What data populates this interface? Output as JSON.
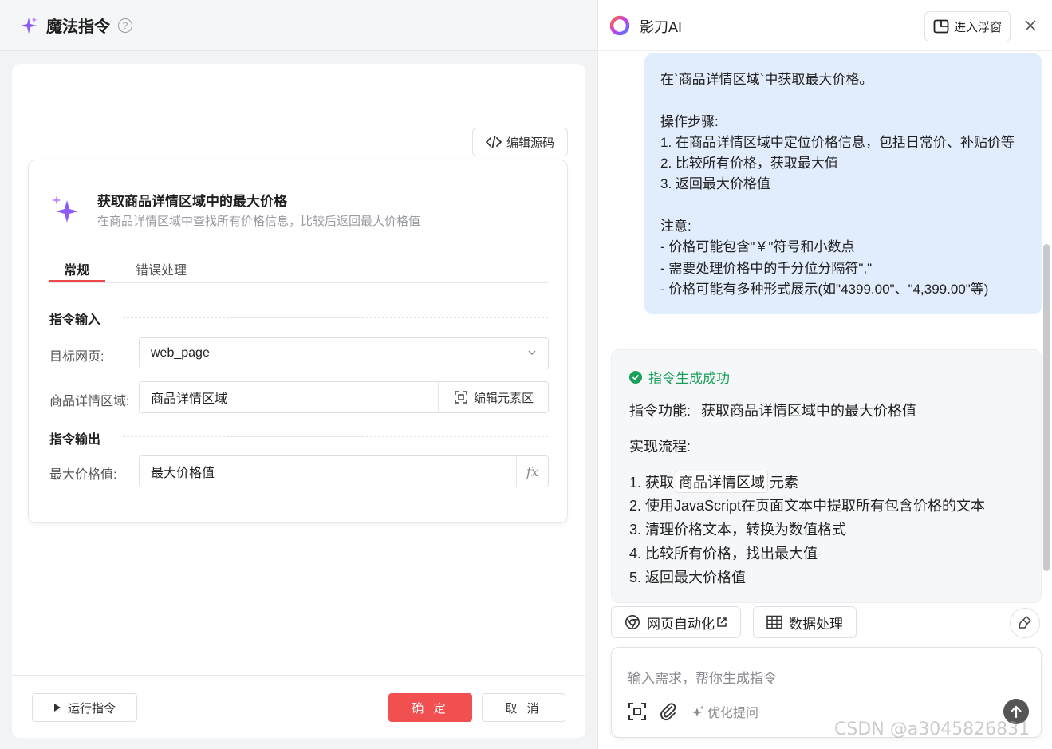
{
  "left": {
    "title": "魔法指令",
    "edit_source_label": "编辑源码",
    "command": {
      "title": "获取商品详情区域中的最大价格",
      "description": "在商品详情区域中查找所有价格信息，比较后返回最大价格值"
    },
    "tabs": [
      "常规",
      "错误处理"
    ],
    "active_tab": "常规",
    "input_section": "指令输入",
    "output_section": "指令输出",
    "fields": {
      "target_page_label": "目标网页:",
      "target_page_value": "web_page",
      "detail_area_label": "商品详情区域:",
      "detail_area_value": "商品详情区域",
      "edit_element_label": "编辑元素区",
      "max_price_label": "最大价格值:",
      "max_price_value": "最大价格值",
      "fx_label": "fx"
    },
    "footer": {
      "run_label": "运行指令",
      "ok_label": "确 定",
      "cancel_label": "取 消"
    }
  },
  "right": {
    "name": "影刀AI",
    "float_label": "进入浮窗",
    "user_message": "在`商品详情区域`中获取最大价格。\n\n操作步骤:\n1. 在商品详情区域中定位价格信息，包括日常价、补贴价等\n2. 比较所有价格，获取最大值\n3. 返回最大价格值\n\n注意:\n- 价格可能包含\"￥\"符号和小数点\n- 需要处理价格中的千分位分隔符\",\"\n- 价格可能有多种形式展示(如\"4399.00\"、\"4,399.00\"等)",
    "ai": {
      "status": "指令生成成功",
      "function_label": "指令功能:",
      "function_value": "获取商品详情区域中的最大价格值",
      "flow_label": "实现流程:",
      "step1_prefix": "1. 获取",
      "step1_chip": "商品详情区域",
      "step1_suffix": "元素",
      "step2": "2. 使用JavaScript在页面文本中提取所有包含价格的文本",
      "step3": "3. 清理价格文本，转换为数值格式",
      "step4": "4. 比较所有价格，找出最大值",
      "step5": "5. 返回最大价格值"
    },
    "tools": [
      "网页自动化",
      "数据处理"
    ],
    "input_placeholder": "输入需求，帮你生成指令",
    "optimize_label": "优化提问"
  },
  "watermark": "CSDN @a3045826831",
  "colors": {
    "primary_red": "#f25050",
    "success_green": "#18a058",
    "bubble_blue": "#e1edfc",
    "sparkle_purple": "#8b5cf6"
  }
}
